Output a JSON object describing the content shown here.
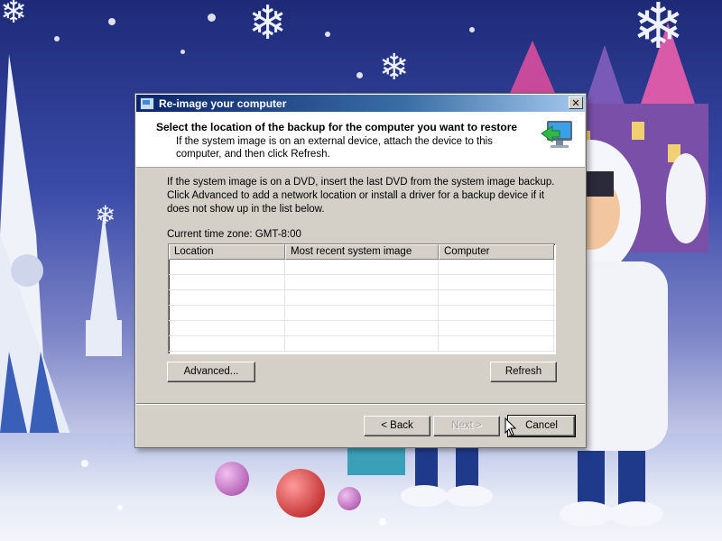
{
  "dialog": {
    "title": "Re-image your computer",
    "header_title": "Select the location of the backup for the computer you want to restore",
    "header_subtitle": "If the system image is on an external device, attach the device to this computer, and then click Refresh.",
    "instructions": "If the system image is on a DVD, insert the last DVD from the system image backup. Click Advanced to add a network location or install a driver for a backup device if it does not show up in the list below.",
    "timezone": "Current time zone: GMT-8:00",
    "table": {
      "columns": [
        "Location",
        "Most recent system image",
        "Computer"
      ],
      "rows": []
    },
    "buttons": {
      "advanced": "Advanced...",
      "refresh": "Refresh",
      "back": "< Back",
      "next": "Next >",
      "cancel": "Cancel"
    },
    "close_glyph": "✕",
    "icons": {
      "title": "window-icon",
      "header": "computer-restore-icon",
      "close": "close-icon"
    }
  },
  "colors": {
    "titlebar_start": "#0a246a",
    "titlebar_end": "#a6caf0",
    "dialog_face": "#d4d0c8"
  }
}
